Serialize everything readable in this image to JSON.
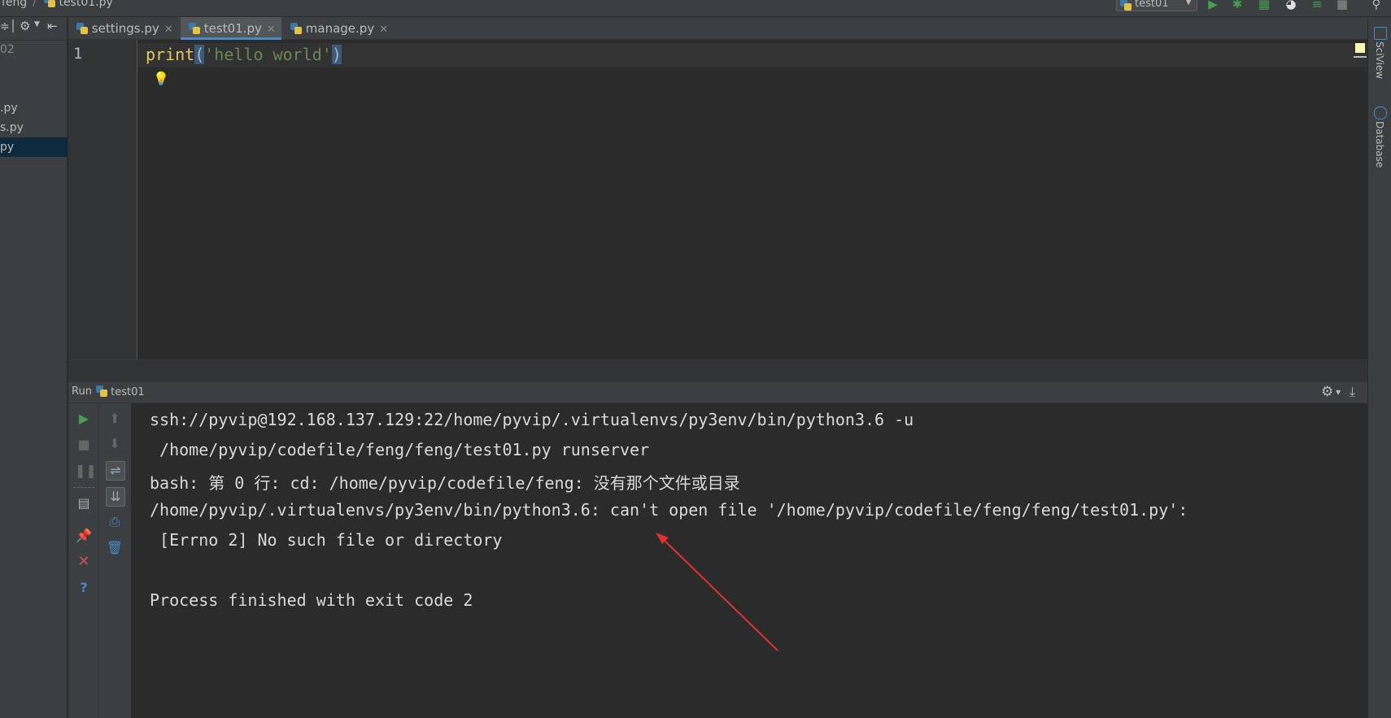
{
  "navbar": {
    "crumbs": [
      "feng",
      "test01.py"
    ],
    "run_config": "test01"
  },
  "project": {
    "header_fragment": "02",
    "items": [
      ".py",
      "s.py",
      "py"
    ]
  },
  "tabs": [
    {
      "label": "settings.py",
      "active": false
    },
    {
      "label": "test01.py",
      "active": true
    },
    {
      "label": "manage.py",
      "active": false
    }
  ],
  "editor": {
    "line_number": "1",
    "code": {
      "func": "print",
      "open": "(",
      "string": "'hello world'",
      "close": ")"
    }
  },
  "right_strip": {
    "sciview": "SciView",
    "database": "Database"
  },
  "run": {
    "title": "Run",
    "config": "test01",
    "output": [
      "ssh://pyvip@192.168.137.129:22/home/pyvip/.virtualenvs/py3env/bin/python3.6 -u",
      " /home/pyvip/codefile/feng/feng/test01.py runserver",
      "bash: 第 0 行: cd: /home/pyvip/codefile/feng: 没有那个文件或目录",
      "/home/pyvip/.virtualenvs/py3env/bin/python3.6: can't open file '/home/pyvip/codefile/feng/feng/test01.py':",
      " [Errno 2] No such file or directory",
      "",
      "Process finished with exit code 2"
    ]
  },
  "colors": {
    "accent": "#4a88c7",
    "run_green": "#499c54",
    "stop_red": "#c75450",
    "annotation_arrow": "#e03232"
  }
}
